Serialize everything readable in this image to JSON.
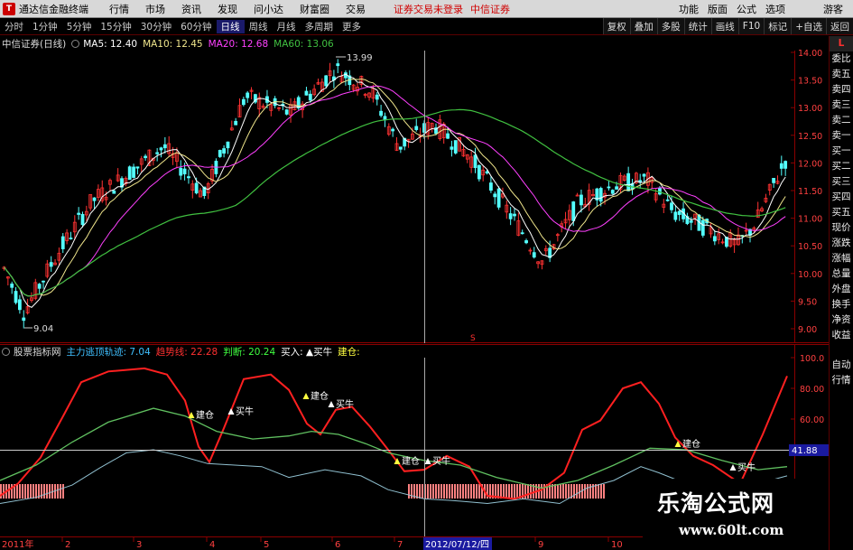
{
  "menubar": {
    "app_name": "通达信金融终端",
    "items": [
      "行情",
      "市场",
      "资讯",
      "发现",
      "问小达",
      "财富圈",
      "交易"
    ],
    "status": "证券交易未登录",
    "broker": "中信证券",
    "right_items": [
      "功能",
      "版面",
      "公式",
      "选项"
    ],
    "guest": "游客"
  },
  "toolbar": {
    "periods": [
      "分时",
      "1分钟",
      "5分钟",
      "15分钟",
      "30分钟",
      "60分钟",
      "日线",
      "周线",
      "月线",
      "多周期",
      "更多"
    ],
    "active_period": "日线",
    "right_buttons": [
      "复权",
      "叠加",
      "多股",
      "统计",
      "画线",
      "F10",
      "标记",
      "+自选",
      "返回"
    ]
  },
  "price_legend": {
    "title": "中信证券(日线)",
    "ma5": "MA5: 12.40",
    "ma10": "MA10: 12.45",
    "ma20": "MA20: 12.68",
    "ma60": "MA60: 13.06"
  },
  "indicator_legend": {
    "name": "股票指标网",
    "main": "主力逃顶轨迹: 7.04",
    "trend": "趋势线: 22.28",
    "judge": "判断: 20.24",
    "buy": "买入: ▲买牛",
    "build": "建仓:"
  },
  "price_axis": [
    "14.00",
    "13.50",
    "13.00",
    "12.50",
    "12.00",
    "11.50",
    "11.00",
    "10.50",
    "10.00",
    "9.50",
    "9.00"
  ],
  "indicator_axis": [
    "100.0",
    "80.00",
    "60.00",
    "40.00"
  ],
  "crosshair_value": "41.88",
  "price_annotations": {
    "high": "13.99",
    "low": "9.04",
    "event_marker": "S"
  },
  "signals": [
    {
      "label": "建仓",
      "kind": "build"
    },
    {
      "label": "买牛",
      "kind": "buy"
    },
    {
      "label": "建仓",
      "kind": "build"
    },
    {
      "label": "买牛",
      "kind": "buy"
    },
    {
      "label": "建仓",
      "kind": "build"
    },
    {
      "label": "买牛",
      "kind": "buy"
    },
    {
      "label": "建仓",
      "kind": "build"
    },
    {
      "label": "买牛",
      "kind": "buy"
    }
  ],
  "time_axis": {
    "year_label": "2011年",
    "months": [
      "2",
      "3",
      "4",
      "5",
      "6",
      "7",
      "9",
      "10"
    ],
    "cursor_date": "2012/07/12/四"
  },
  "side_panel": [
    "L",
    "委比",
    "卖五",
    "卖四",
    "卖三",
    "卖二",
    "卖一",
    "买一",
    "买二",
    "买三",
    "买四",
    "买五",
    "现价",
    "涨跌",
    "涨幅",
    "总量",
    "外盘",
    "换手",
    "净资",
    "收益"
  ],
  "side_panel_bottom": [
    "自动",
    "行情"
  ],
  "watermark": {
    "title": "乐淘公式网",
    "url": "www.60lt.com"
  },
  "colors": {
    "up": "#ff3232",
    "down": "#54ffff",
    "ma5": "#ffffff",
    "ma10": "#f0e68c",
    "ma20": "#ff40ff",
    "ma60": "#40c040",
    "trend": "#ff2020",
    "judge": "#60c060",
    "main": "#90c0d0"
  }
}
